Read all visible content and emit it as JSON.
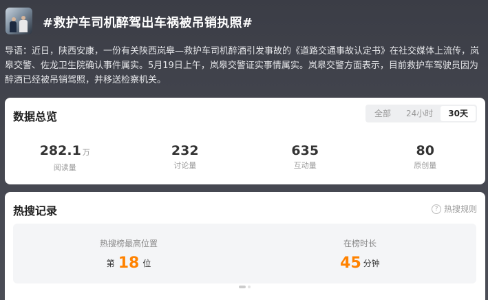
{
  "header": {
    "title": "#救护车司机醉驾出车祸被吊销执照#",
    "intro": "导语：近日，陕西安康，一份有关陕西岚皋—救护车司机醉酒引发事故的《道路交通事故认定书》在社交媒体上流传，岚皋交警、佐龙卫生院确认事件属实。5月19日上午，岚皋交警证实事情属实。岚皋交警方面表示，目前救护车驾驶员因为醉酒已经被吊销驾照，并移送检察机关。"
  },
  "overview": {
    "title": "数据总览",
    "tabs": [
      {
        "label": "全部",
        "active": false
      },
      {
        "label": "24小时",
        "active": false
      },
      {
        "label": "30天",
        "active": true
      }
    ],
    "stats": [
      {
        "value": "282.1",
        "unit": "万",
        "label": "阅读量"
      },
      {
        "value": "232",
        "unit": "",
        "label": "讨论量"
      },
      {
        "value": "635",
        "unit": "",
        "label": "互动量"
      },
      {
        "value": "80",
        "unit": "",
        "label": "原创量"
      }
    ]
  },
  "hot": {
    "title": "热搜记录",
    "rules_label": "热搜规则",
    "rules_icon": "question-circle-icon",
    "peak_label": "热搜榜最高位置",
    "peak_prefix": "第",
    "peak_value": "18",
    "peak_suffix": "位",
    "duration_label": "在榜时长",
    "duration_value": "45",
    "duration_suffix": "分钟"
  },
  "colors": {
    "accent": "#ff8200",
    "background": "#3f414a"
  },
  "pagination": {
    "pages": 2,
    "current": 1
  }
}
